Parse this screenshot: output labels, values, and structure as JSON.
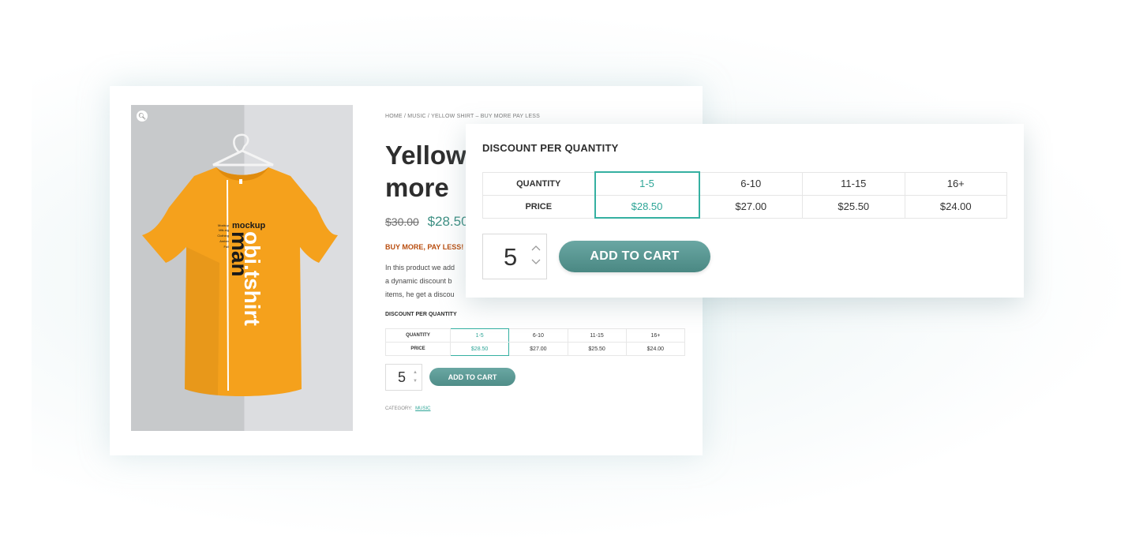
{
  "product": {
    "breadcrumb": "HOME / MUSIC / YELLOW SHIRT – BUY MORE PAY LESS",
    "title": "Yellow shirt – Buy more pay less",
    "title_visible_line1": "Yellow",
    "title_visible_line2": "more",
    "old_price": "$30.00",
    "new_price": "$28.50",
    "promo": "BUY MORE, PAY LESS!",
    "description_lines": [
      "In this product we add",
      "a dynamic discount b",
      "items, he get a discou"
    ],
    "category_label": "CATEGORY:",
    "category_link": "MUSIC",
    "zoom_icon": "magnifier-icon",
    "shirt_print": {
      "small_word": "mockup",
      "big_word_1": "obi.tshirt",
      "big_word_2": "man",
      "side_lines": [
        "Mockup",
        "Mtk-sig",
        "Clothing",
        "Amber",
        "Full"
      ]
    },
    "shirt_color": "#f5a11c"
  },
  "discount": {
    "heading": "DISCOUNT PER QUANTITY",
    "row_labels": [
      "QUANTITY",
      "PRICE"
    ],
    "tiers": [
      {
        "qty": "1-5",
        "price": "$28.50",
        "selected": true
      },
      {
        "qty": "6-10",
        "price": "$27.00",
        "selected": false
      },
      {
        "qty": "11-15",
        "price": "$25.50",
        "selected": false
      },
      {
        "qty": "16+",
        "price": "$24.00",
        "selected": false
      }
    ]
  },
  "cart": {
    "quantity": "5",
    "button_label": "ADD TO CART"
  },
  "colors": {
    "accent": "#35b0a1",
    "button": "#5a9994",
    "promo": "#b94e10"
  }
}
